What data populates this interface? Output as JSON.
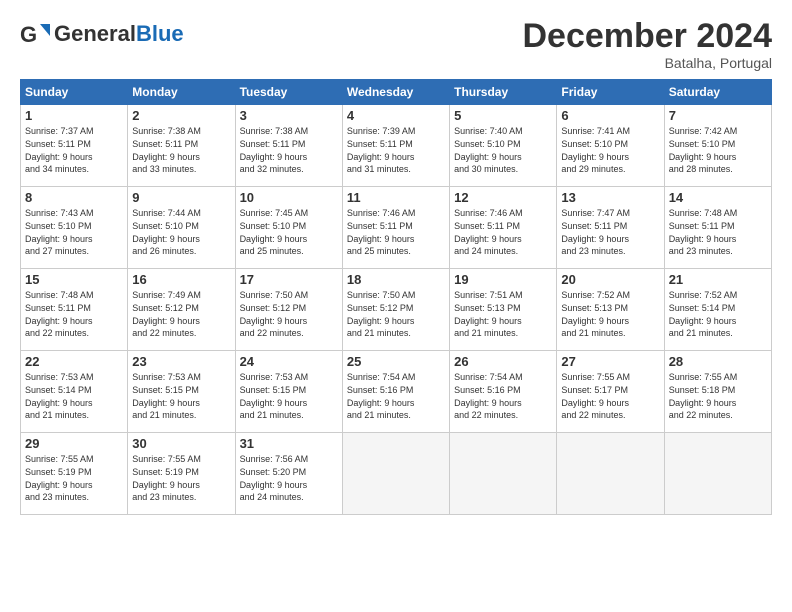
{
  "logo": {
    "line1": "General",
    "line2": "Blue"
  },
  "title": "December 2024",
  "location": "Batalha, Portugal",
  "weekdays": [
    "Sunday",
    "Monday",
    "Tuesday",
    "Wednesday",
    "Thursday",
    "Friday",
    "Saturday"
  ],
  "weeks": [
    [
      {
        "day": "1",
        "info": "Sunrise: 7:37 AM\nSunset: 5:11 PM\nDaylight: 9 hours\nand 34 minutes."
      },
      {
        "day": "2",
        "info": "Sunrise: 7:38 AM\nSunset: 5:11 PM\nDaylight: 9 hours\nand 33 minutes."
      },
      {
        "day": "3",
        "info": "Sunrise: 7:38 AM\nSunset: 5:11 PM\nDaylight: 9 hours\nand 32 minutes."
      },
      {
        "day": "4",
        "info": "Sunrise: 7:39 AM\nSunset: 5:11 PM\nDaylight: 9 hours\nand 31 minutes."
      },
      {
        "day": "5",
        "info": "Sunrise: 7:40 AM\nSunset: 5:10 PM\nDaylight: 9 hours\nand 30 minutes."
      },
      {
        "day": "6",
        "info": "Sunrise: 7:41 AM\nSunset: 5:10 PM\nDaylight: 9 hours\nand 29 minutes."
      },
      {
        "day": "7",
        "info": "Sunrise: 7:42 AM\nSunset: 5:10 PM\nDaylight: 9 hours\nand 28 minutes."
      }
    ],
    [
      {
        "day": "8",
        "info": "Sunrise: 7:43 AM\nSunset: 5:10 PM\nDaylight: 9 hours\nand 27 minutes."
      },
      {
        "day": "9",
        "info": "Sunrise: 7:44 AM\nSunset: 5:10 PM\nDaylight: 9 hours\nand 26 minutes."
      },
      {
        "day": "10",
        "info": "Sunrise: 7:45 AM\nSunset: 5:10 PM\nDaylight: 9 hours\nand 25 minutes."
      },
      {
        "day": "11",
        "info": "Sunrise: 7:46 AM\nSunset: 5:11 PM\nDaylight: 9 hours\nand 25 minutes."
      },
      {
        "day": "12",
        "info": "Sunrise: 7:46 AM\nSunset: 5:11 PM\nDaylight: 9 hours\nand 24 minutes."
      },
      {
        "day": "13",
        "info": "Sunrise: 7:47 AM\nSunset: 5:11 PM\nDaylight: 9 hours\nand 23 minutes."
      },
      {
        "day": "14",
        "info": "Sunrise: 7:48 AM\nSunset: 5:11 PM\nDaylight: 9 hours\nand 23 minutes."
      }
    ],
    [
      {
        "day": "15",
        "info": "Sunrise: 7:48 AM\nSunset: 5:11 PM\nDaylight: 9 hours\nand 22 minutes."
      },
      {
        "day": "16",
        "info": "Sunrise: 7:49 AM\nSunset: 5:12 PM\nDaylight: 9 hours\nand 22 minutes."
      },
      {
        "day": "17",
        "info": "Sunrise: 7:50 AM\nSunset: 5:12 PM\nDaylight: 9 hours\nand 22 minutes."
      },
      {
        "day": "18",
        "info": "Sunrise: 7:50 AM\nSunset: 5:12 PM\nDaylight: 9 hours\nand 21 minutes."
      },
      {
        "day": "19",
        "info": "Sunrise: 7:51 AM\nSunset: 5:13 PM\nDaylight: 9 hours\nand 21 minutes."
      },
      {
        "day": "20",
        "info": "Sunrise: 7:52 AM\nSunset: 5:13 PM\nDaylight: 9 hours\nand 21 minutes."
      },
      {
        "day": "21",
        "info": "Sunrise: 7:52 AM\nSunset: 5:14 PM\nDaylight: 9 hours\nand 21 minutes."
      }
    ],
    [
      {
        "day": "22",
        "info": "Sunrise: 7:53 AM\nSunset: 5:14 PM\nDaylight: 9 hours\nand 21 minutes."
      },
      {
        "day": "23",
        "info": "Sunrise: 7:53 AM\nSunset: 5:15 PM\nDaylight: 9 hours\nand 21 minutes."
      },
      {
        "day": "24",
        "info": "Sunrise: 7:53 AM\nSunset: 5:15 PM\nDaylight: 9 hours\nand 21 minutes."
      },
      {
        "day": "25",
        "info": "Sunrise: 7:54 AM\nSunset: 5:16 PM\nDaylight: 9 hours\nand 21 minutes."
      },
      {
        "day": "26",
        "info": "Sunrise: 7:54 AM\nSunset: 5:16 PM\nDaylight: 9 hours\nand 22 minutes."
      },
      {
        "day": "27",
        "info": "Sunrise: 7:55 AM\nSunset: 5:17 PM\nDaylight: 9 hours\nand 22 minutes."
      },
      {
        "day": "28",
        "info": "Sunrise: 7:55 AM\nSunset: 5:18 PM\nDaylight: 9 hours\nand 22 minutes."
      }
    ],
    [
      {
        "day": "29",
        "info": "Sunrise: 7:55 AM\nSunset: 5:19 PM\nDaylight: 9 hours\nand 23 minutes."
      },
      {
        "day": "30",
        "info": "Sunrise: 7:55 AM\nSunset: 5:19 PM\nDaylight: 9 hours\nand 23 minutes."
      },
      {
        "day": "31",
        "info": "Sunrise: 7:56 AM\nSunset: 5:20 PM\nDaylight: 9 hours\nand 24 minutes."
      },
      {
        "day": "",
        "info": ""
      },
      {
        "day": "",
        "info": ""
      },
      {
        "day": "",
        "info": ""
      },
      {
        "day": "",
        "info": ""
      }
    ]
  ]
}
